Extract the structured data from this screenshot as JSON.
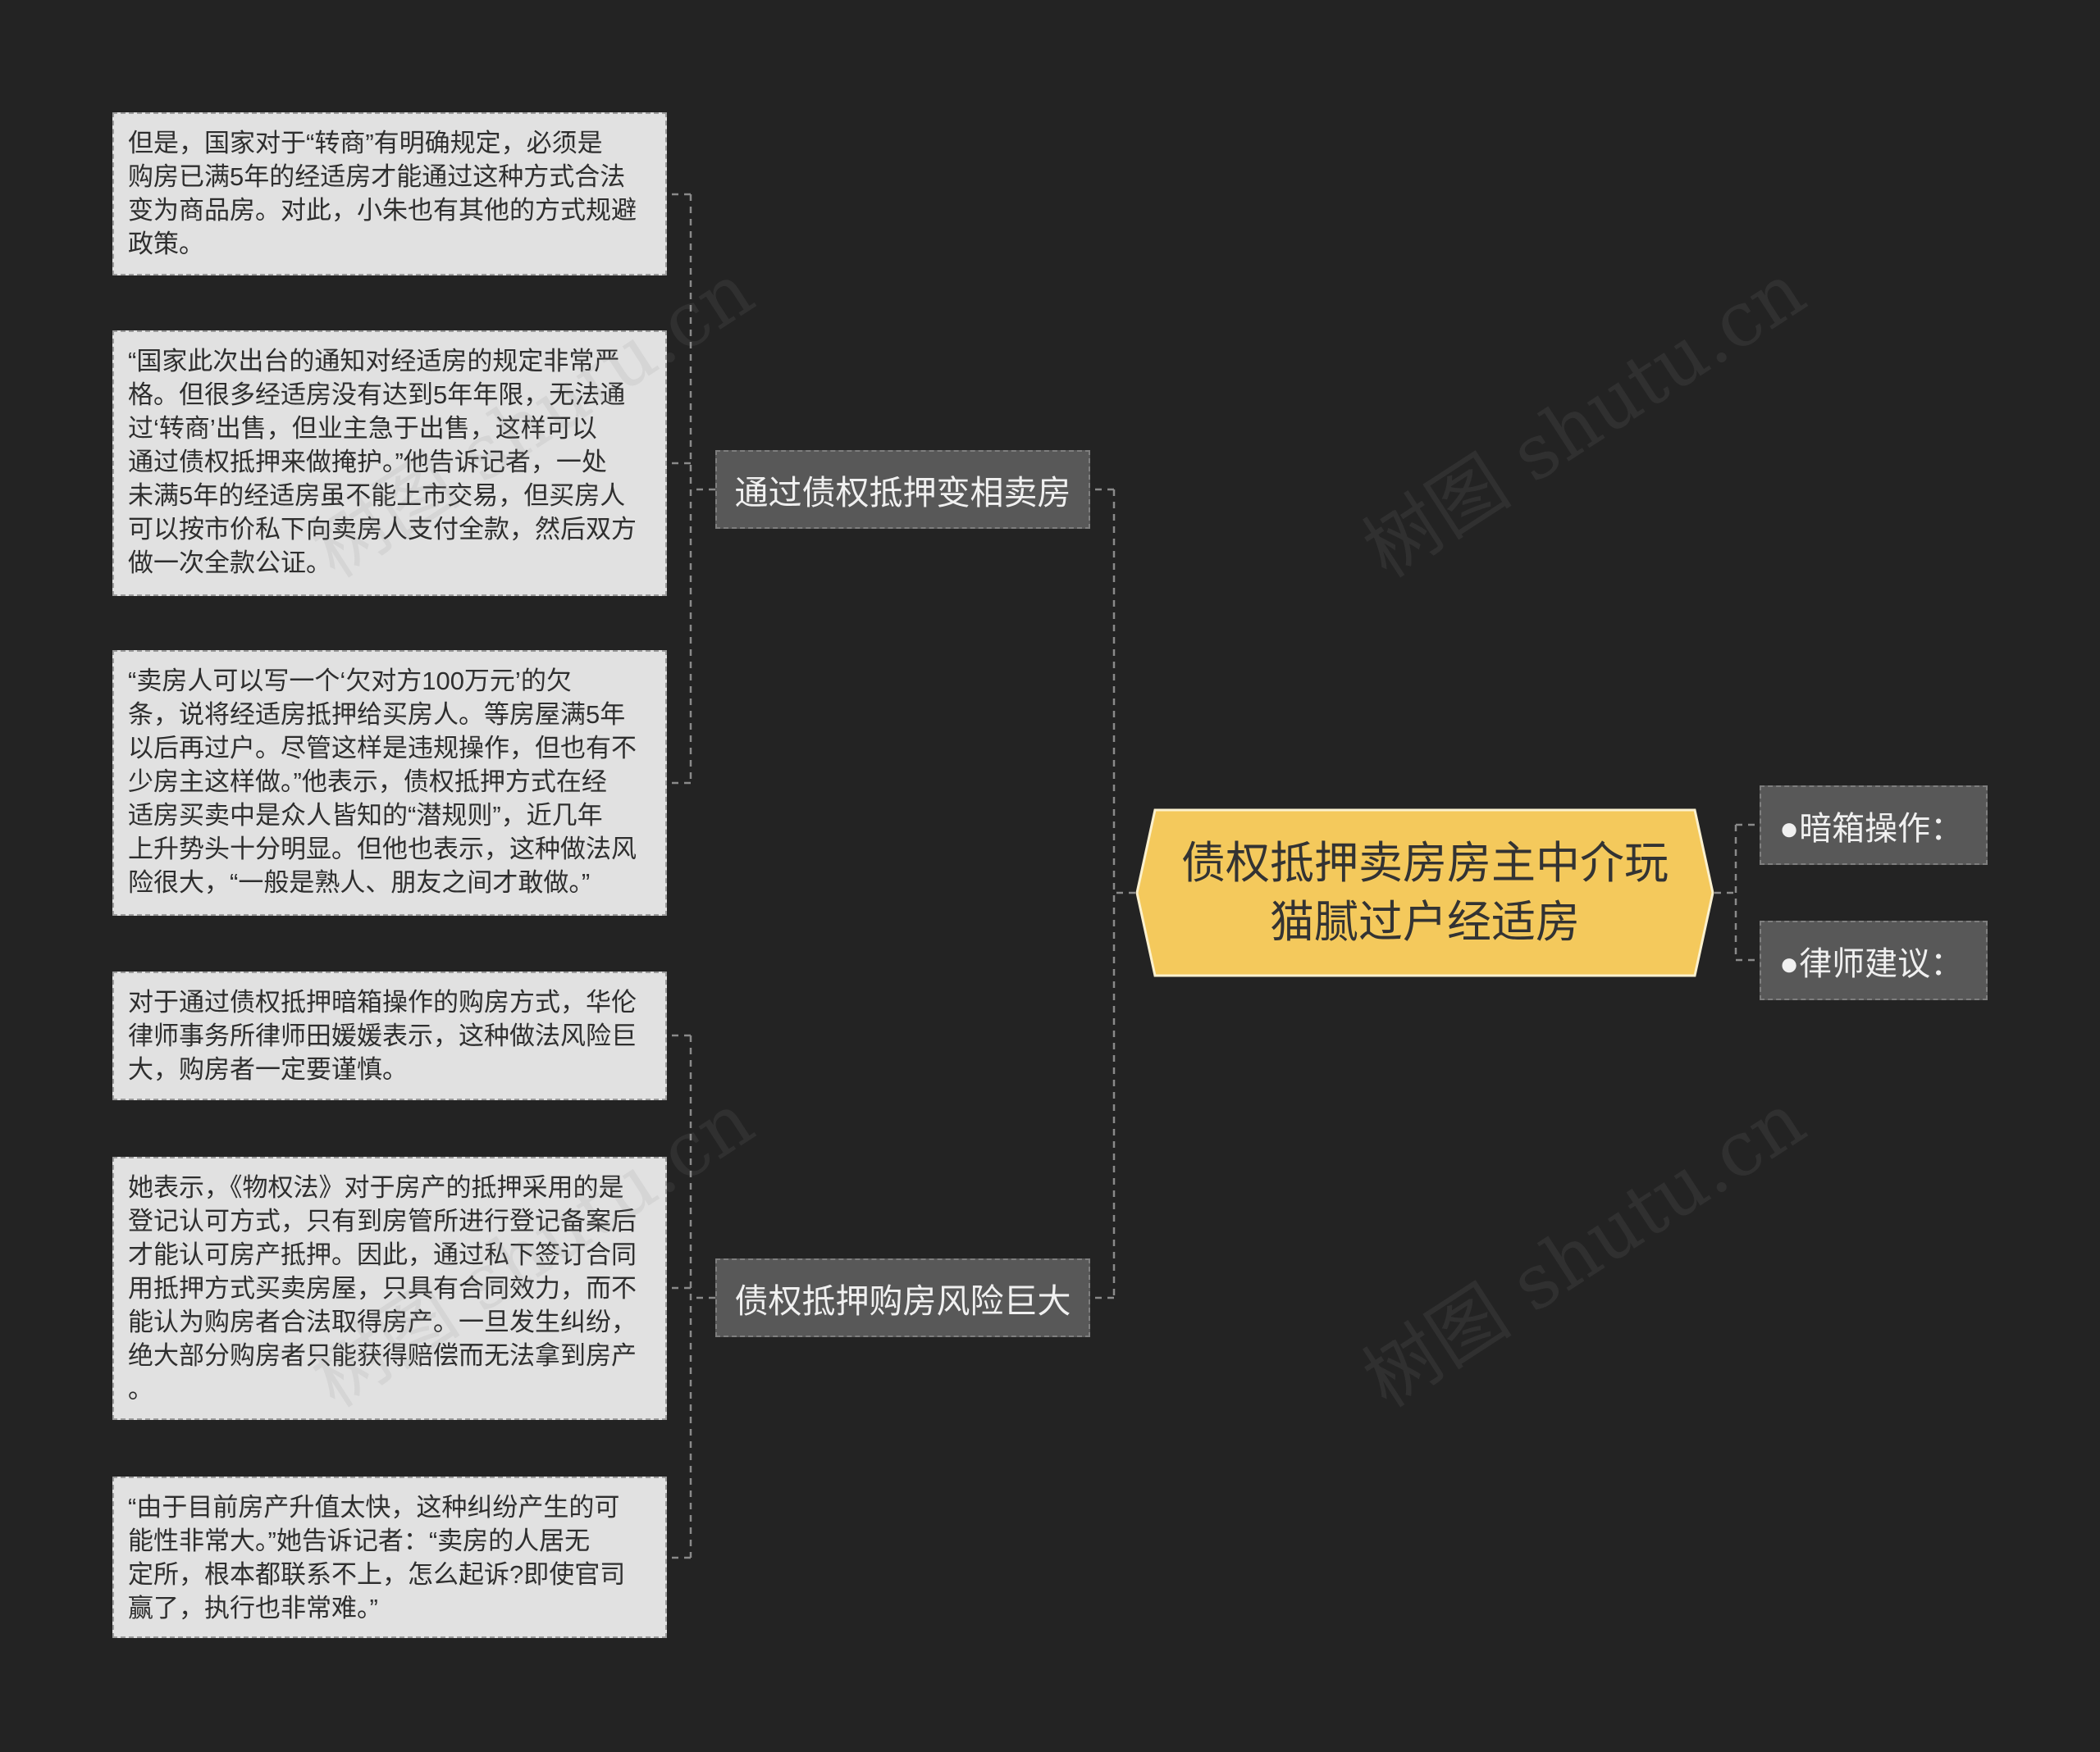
{
  "colors": {
    "background": "#232323",
    "root_fill": "#f4c95c",
    "root_border": "#fbf1cf",
    "root_text": "#333333",
    "branch_fill": "#585858",
    "branch_border": "#7e7e7e",
    "branch_text": "#f0f0f0",
    "leaf_fill": "#e1e1e1",
    "leaf_border": "#9b9b9b",
    "leaf_text": "#2e2e2e",
    "connector": "#8a8a8a"
  },
  "mind_map": {
    "root": {
      "lines": [
        "债权抵押卖房房主中介玩",
        "猫腻过户经适房"
      ]
    },
    "left_branches": [
      {
        "label": "通过债权抵押变相卖房",
        "children": [
          {
            "lines": [
              "但是，国家对于“转商”有明确规定，必须是",
              "购房已满5年的经适房才能通过这种方式合法",
              "变为商品房。对此，小朱也有其他的方式规避",
              "政策。"
            ]
          },
          {
            "lines": [
              "“国家此次出台的通知对经适房的规定非常严",
              "格。但很多经适房没有达到5年年限，无法通",
              "过‘转商’出售，但业主急于出售，这样可以",
              "通过债权抵押来做掩护。”他告诉记者，一处",
              "未满5年的经适房虽不能上市交易，但买房人",
              "可以按市价私下向卖房人支付全款，然后双方",
              "做一次全款公证。"
            ]
          },
          {
            "lines": [
              "“卖房人可以写一个‘欠对方100万元’的欠",
              "条，说将经适房抵押给买房人。等房屋满5年",
              "以后再过户。尽管这样是违规操作，但也有不",
              "少房主这样做。”他表示，债权抵押方式在经",
              "适房买卖中是众人皆知的“潜规则”，近几年",
              "上升势头十分明显。但他也表示，这种做法风",
              "险很大，“一般是熟人、朋友之间才敢做。”"
            ]
          }
        ]
      },
      {
        "label": "债权抵押购房风险巨大",
        "children": [
          {
            "lines": [
              "对于通过债权抵押暗箱操作的购房方式，华伦",
              "律师事务所律师田媛媛表示，这种做法风险巨",
              "大，购房者一定要谨慎。"
            ]
          },
          {
            "lines": [
              "她表示，《物权法》对于房产的抵押采用的是",
              "登记认可方式，只有到房管所进行登记备案后",
              "才能认可房产抵押。因此，通过私下签订合同",
              "用抵押方式买卖房屋，只具有合同效力，而不",
              "能认为购房者合法取得房产。一旦发生纠纷，",
              "绝大部分购房者只能获得赔偿而无法拿到房产",
              "。"
            ]
          },
          {
            "lines": [
              "“由于目前房产升值太快，这种纠纷产生的可",
              "能性非常大。”她告诉记者：“卖房的人居无",
              "定所，根本都联系不上，怎么起诉?即使官司",
              "赢了，执行也非常难。”"
            ]
          }
        ]
      }
    ],
    "right_branches": [
      {
        "label": "●暗箱操作："
      },
      {
        "label": "●律师建议："
      }
    ]
  },
  "watermark": "树图 shutu.cn"
}
